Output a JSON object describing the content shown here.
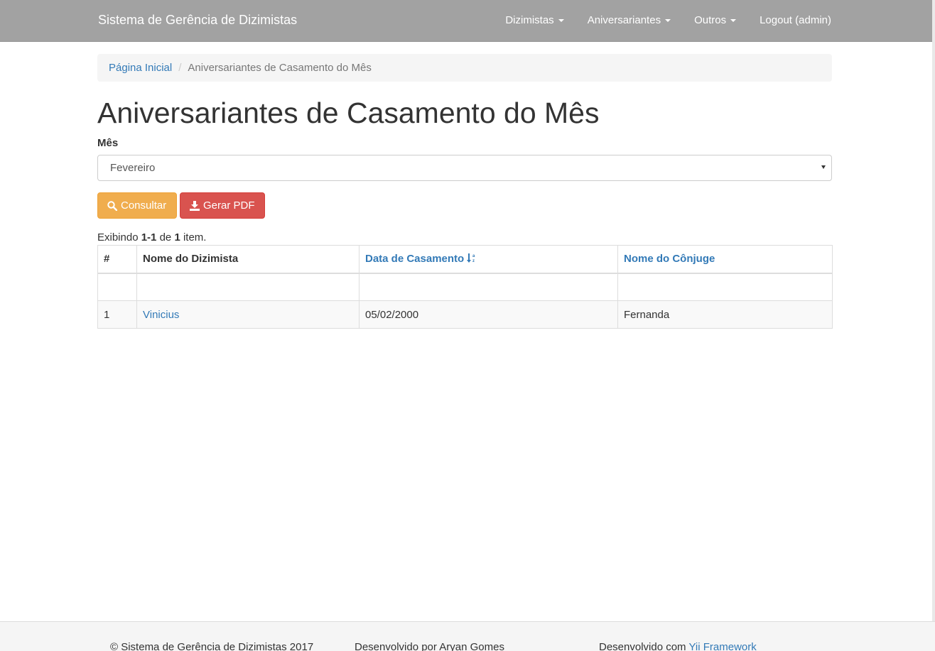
{
  "navbar": {
    "brand": "Sistema de Gerência de Dizimistas",
    "items": [
      {
        "label": "Dizimistas",
        "dropdown": true
      },
      {
        "label": "Aniversariantes",
        "dropdown": true
      },
      {
        "label": "Outros",
        "dropdown": true
      },
      {
        "label": "Logout (admin)",
        "dropdown": false
      }
    ]
  },
  "breadcrumb": {
    "home": "Página Inicial",
    "current": "Aniversariantes de Casamento do Mês"
  },
  "page": {
    "title": "Aniversariantes de Casamento do Mês"
  },
  "form": {
    "month_label": "Mês",
    "month_value": "Fevereiro",
    "consult_label": "Consultar",
    "pdf_label": "Gerar PDF"
  },
  "summary": {
    "prefix": "Exibindo ",
    "range": "1-1",
    "middle": " de ",
    "total": "1",
    "suffix": " item."
  },
  "table": {
    "columns": [
      "#",
      "Nome do Dizimista",
      "Data de Casamento",
      "Nome do Cônjuge"
    ],
    "rows": [
      {
        "num": "1",
        "name": "Vinicius",
        "date": "05/02/2000",
        "spouse": "Fernanda"
      }
    ]
  },
  "footer": {
    "copyright": "© Sistema de Gerência de Dizimistas 2017",
    "developer": "Desenvolvido por Aryan Gomes",
    "built_with_prefix": "Desenvolvido com ",
    "built_with_link": "Yii Framework"
  },
  "colors": {
    "navbar": "#a2a2a2",
    "link": "#337ab7",
    "warning": "#f0ad4e",
    "danger": "#d9534f"
  },
  "icons": {
    "consult": "search-icon",
    "pdf": "download-icon",
    "sort": "sort-alpha-icon",
    "dropdown": "caret-down-icon"
  }
}
